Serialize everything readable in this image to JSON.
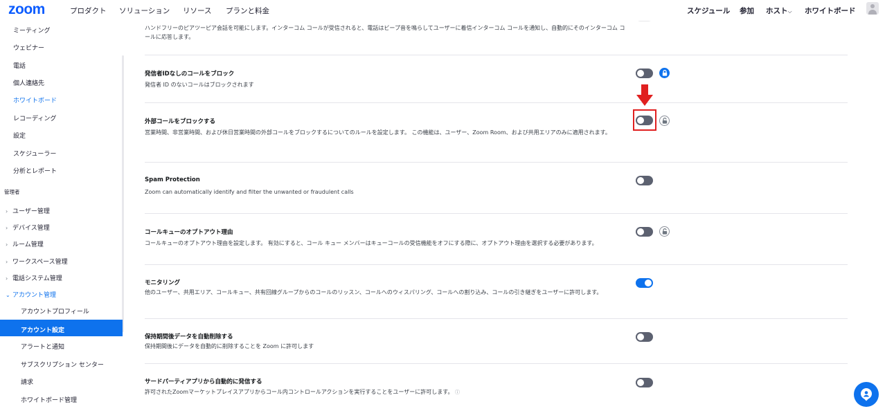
{
  "header": {
    "logo": "zoom",
    "nav_left": [
      "プロダクト",
      "ソリューション",
      "リソース",
      "プランと料金"
    ],
    "nav_right": {
      "schedule": "スケジュール",
      "join": "参加",
      "host": "ホスト",
      "host_chevron": "⌵",
      "whiteboard": "ホワイトボード"
    }
  },
  "sidebar": {
    "items": [
      "ミーティング",
      "ウェビナー",
      "電話",
      "個人連絡先",
      "ホワイトボード",
      "レコーディング",
      "設定",
      "スケジューラー",
      "分析とレポート"
    ],
    "admin_header": "管理者",
    "admin_items": [
      "ユーザー管理",
      "デバイス管理",
      "ルーム管理",
      "ワークスペース管理",
      "電話システム管理",
      "アカウント管理"
    ],
    "collapsed_chevron": "›",
    "expanded_chevron": "⌄",
    "sub_items": [
      "アカウントプロフィール",
      "アカウント設定",
      "アラートと通知",
      "サブスクリプション センター",
      "請求",
      "ホワイトボード管理"
    ]
  },
  "settings": [
    {
      "title": "",
      "desc": "ハンドフリーのピアツーピア会話を可能にします。インターコム コールが受信されると、電話はビープ音を鳴らしてユーザーに着信インターコム コールを通知し、自動的にそのインターコム コールに応答します。",
      "state": "off"
    },
    {
      "title": "発信者IDなしのコールをブロック",
      "desc": "発信者 ID のないコールはブロックされます",
      "state": "off"
    },
    {
      "title": "外部コールをブロックする",
      "desc": "営業時間、非営業時間、および休日営業時間の外部コールをブロックするについてのルールを設定します。 この機能は、ユーザー、Zoom Room、および共用エリアのみに適用されます。",
      "state": "off"
    },
    {
      "title": "Spam Protection",
      "desc": "Zoom can automatically identify and filter the unwanted or fraudulent calls",
      "state": "off"
    },
    {
      "title": "コールキューのオプトアウト理由",
      "desc": "コールキューのオプトアウト理由を設定します。 有効にすると、コール キュー メンバーはキューコールの受信機能をオフにする際に、オプトアウト理由を選択する必要があります。",
      "state": "off"
    },
    {
      "title": "モニタリング",
      "desc": "他のユーザー、共用エリア、コールキュー、共有回線グループからのコールのリッスン、コールへのウィスパリング、コールへの割り込み、コールの引き継ぎをユーザーに許可します。",
      "state": "on"
    },
    {
      "title": "保持期間後データを自動削除する",
      "desc": "保持期間後にデータを自動的に削除することを Zoom に許可します",
      "state": "off"
    },
    {
      "title": "サードパーティアプリから自動的に発信する",
      "desc": "許可されたZoomマーケットプレイスアプリからコール内コントロールアクションを実行することをユーザーに許可します。",
      "info_icon": "ⓘ",
      "state": "off"
    }
  ],
  "colors": {
    "accent": "#0e72ed",
    "highlight": "#e02020",
    "logo": "#0b5cff"
  },
  "icons": [
    "lock-icon",
    "red-down-arrow-icon",
    "help-icon"
  ]
}
